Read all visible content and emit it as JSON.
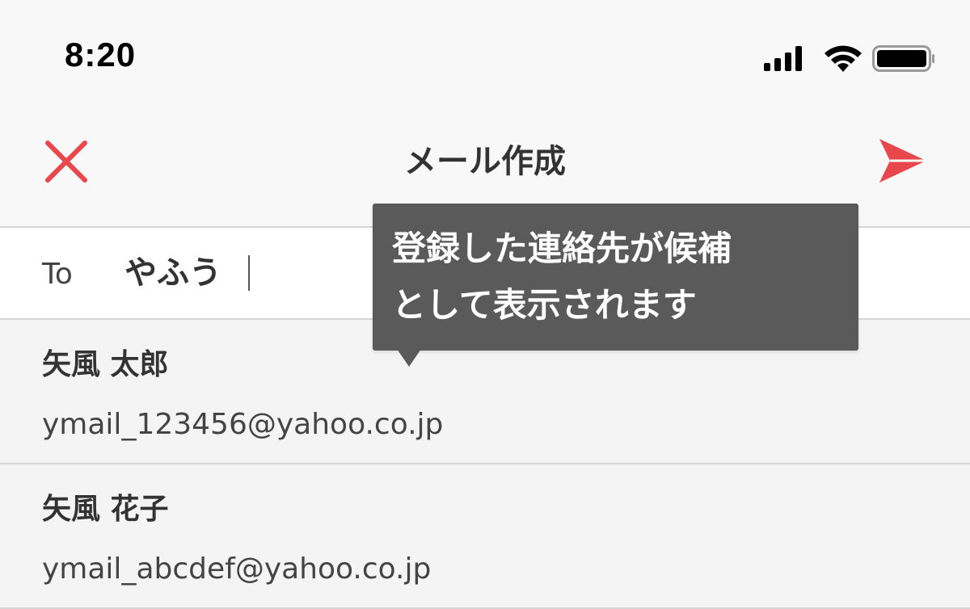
{
  "status_bar": {
    "time": "8:20",
    "icons": [
      "cellular-signal-icon",
      "wifi-icon",
      "battery-icon"
    ]
  },
  "nav": {
    "title": "メール作成",
    "close_icon": "close-icon",
    "send_icon": "send-icon"
  },
  "compose": {
    "to_label": "To",
    "to_value": "やふう"
  },
  "tooltip": {
    "line1": "登録した連絡先が候補",
    "line2": "として表示されます"
  },
  "suggestions": [
    {
      "name": "矢風 太郎",
      "email": "ymail_123456@yahoo.co.jp"
    },
    {
      "name": "矢風 花子",
      "email": "ymail_abcdef@yahoo.co.jp"
    }
  ],
  "colors": {
    "accent": "#e8474b",
    "tooltip_bg": "#5a5a5a",
    "suggestion_bg": "#f4f4f4"
  }
}
